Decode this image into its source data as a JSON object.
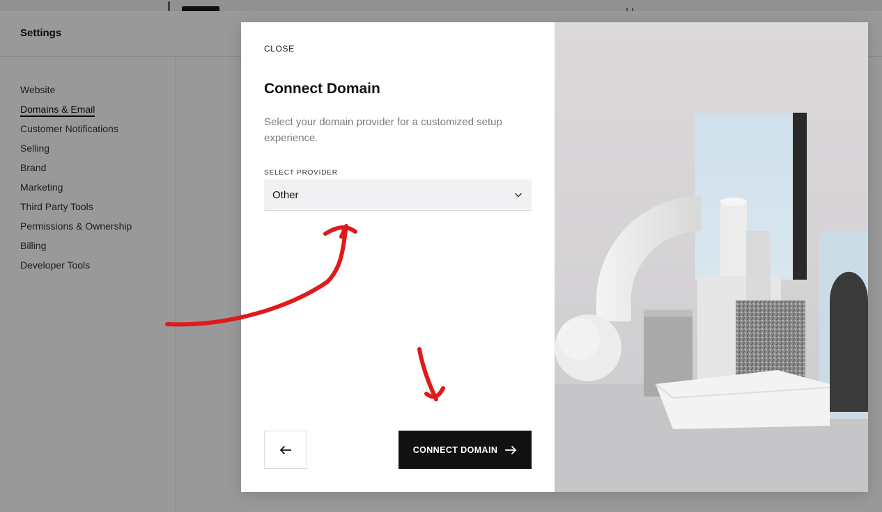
{
  "settings": {
    "title": "Settings",
    "nav": [
      {
        "label": "Website",
        "active": false
      },
      {
        "label": "Domains & Email",
        "active": true
      },
      {
        "label": "Customer Notifications",
        "active": false
      },
      {
        "label": "Selling",
        "active": false
      },
      {
        "label": "Brand",
        "active": false
      },
      {
        "label": "Marketing",
        "active": false
      },
      {
        "label": "Third Party Tools",
        "active": false
      },
      {
        "label": "Permissions & Ownership",
        "active": false
      },
      {
        "label": "Billing",
        "active": false
      },
      {
        "label": "Developer Tools",
        "active": false
      }
    ]
  },
  "modal": {
    "close_label": "CLOSE",
    "title": "Connect Domain",
    "description": "Select your domain provider for a customized setup experience.",
    "provider_label": "SELECT PROVIDER",
    "provider_value": "Other",
    "back_icon": "arrow-left-icon",
    "connect_label": "CONNECT DOMAIN",
    "connect_icon": "arrow-right-icon"
  },
  "colors": {
    "annotation_red": "#e0191a",
    "button_dark": "#111111",
    "select_bg": "#f1f1f3"
  }
}
